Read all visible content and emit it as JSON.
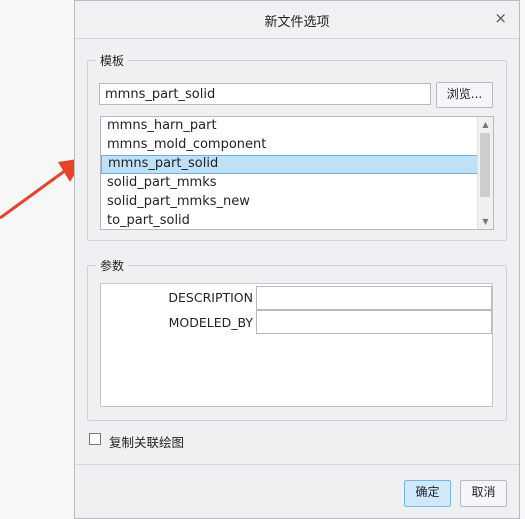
{
  "dialog": {
    "title": "新文件选项",
    "close_icon": "×"
  },
  "template_group": {
    "legend": "模板",
    "input_value": "mmns_part_solid",
    "browse_label": "浏览...",
    "items": [
      {
        "label": "mmns_harn_part",
        "selected": false
      },
      {
        "label": "mmns_mold_component",
        "selected": false
      },
      {
        "label": "mmns_part_solid",
        "selected": true
      },
      {
        "label": "solid_part_mmks",
        "selected": false
      },
      {
        "label": "solid_part_mmks_new",
        "selected": false
      },
      {
        "label": "to_part_solid",
        "selected": false
      }
    ],
    "scroll_up_icon": "▲",
    "scroll_down_icon": "▼"
  },
  "params_group": {
    "legend": "参数",
    "rows": [
      {
        "label": "DESCRIPTION",
        "value": ""
      },
      {
        "label": "MODELED_BY",
        "value": ""
      }
    ]
  },
  "copy_drawing": {
    "label": "复制关联绘图",
    "checked": false
  },
  "footer": {
    "ok_label": "确定",
    "cancel_label": "取消"
  },
  "colors": {
    "selection": "#bfe1f7",
    "primary_button": "#cfe9fb",
    "annotation_arrow": "#e8422b"
  }
}
